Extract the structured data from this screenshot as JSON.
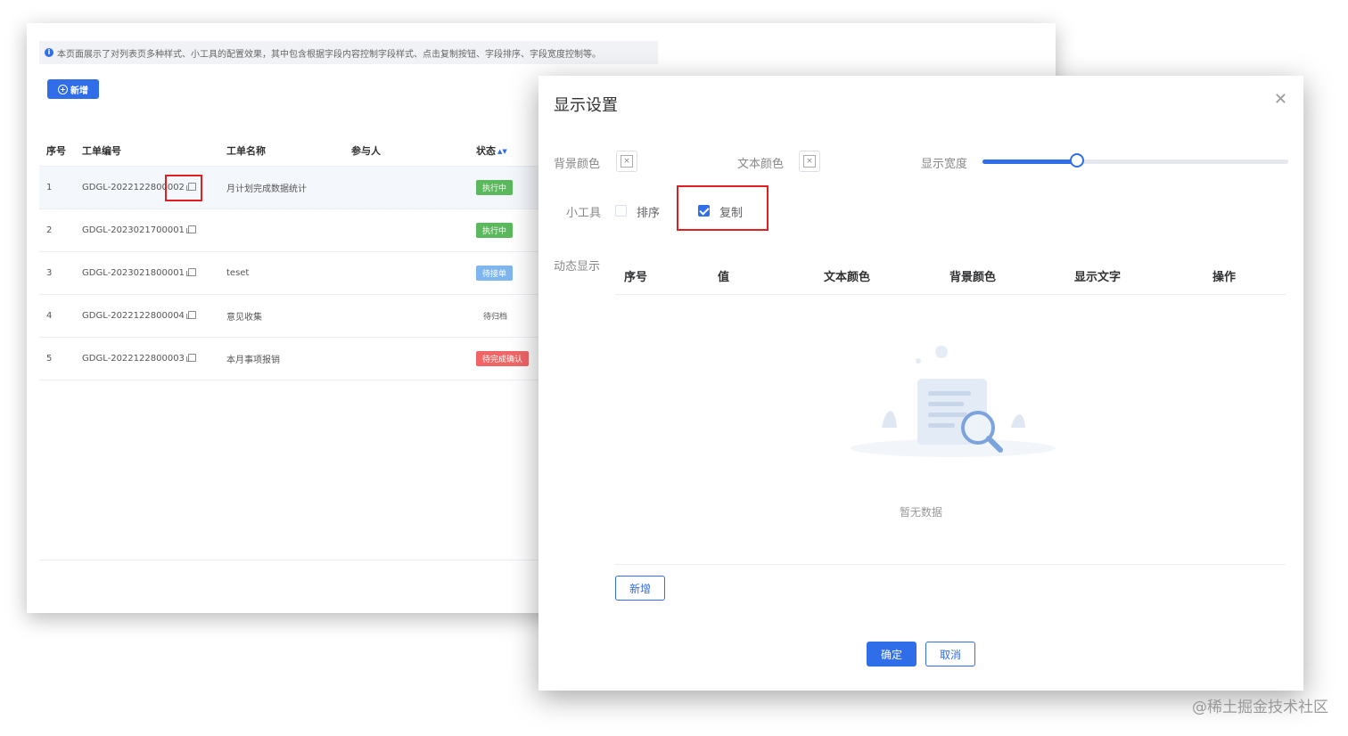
{
  "notice": "本页面展示了对列表页多种样式、小工具的配置效果，其中包含根据字段内容控制字段样式、点击复制按钮、字段排序、字段宽度控制等。",
  "toolbar": {
    "add_label": "新增"
  },
  "table": {
    "headers": [
      "序号",
      "工单编号",
      "工单名称",
      "参与人",
      "状态"
    ],
    "rows": [
      {
        "index": "1",
        "code": "GDGL-2022122800002",
        "name": "月计划完成数据统计",
        "participant": "",
        "status": "执行中",
        "status_color": "#5cb85c"
      },
      {
        "index": "2",
        "code": "GDGL-2023021700001",
        "name": "",
        "participant": "",
        "status": "执行中",
        "status_color": "#5cb85c"
      },
      {
        "index": "3",
        "code": "GDGL-2023021800001",
        "name": "teset",
        "participant": "",
        "status": "待接单",
        "status_color": "#7fb6f0"
      },
      {
        "index": "4",
        "code": "GDGL-2022122800004",
        "name": "意见收集",
        "participant": "",
        "status": "待归档",
        "status_color": ""
      },
      {
        "index": "5",
        "code": "GDGL-2022122800003",
        "name": "本月事项报销",
        "participant": "",
        "status": "待完成确认",
        "status_color": "#f06666"
      }
    ]
  },
  "dialog": {
    "title": "显示设置",
    "bg_color_label": "背景颜色",
    "text_color_label": "文本颜色",
    "width_label": "显示宽度",
    "width_value": 0.31,
    "tools_label": "小工具",
    "sort_label": "排序",
    "sort_checked": false,
    "copy_label": "复制",
    "copy_checked": true,
    "dynamic_label": "动态显示",
    "columns": [
      "序号",
      "值",
      "文本颜色",
      "背景颜色",
      "显示文字",
      "操作"
    ],
    "empty_text": "暂无数据",
    "add_label": "新增",
    "confirm_label": "确定",
    "cancel_label": "取消"
  },
  "credit": "@稀土掘金技术社区",
  "colors": {
    "primary": "#2f6ee8",
    "highlight": "#e02020"
  }
}
